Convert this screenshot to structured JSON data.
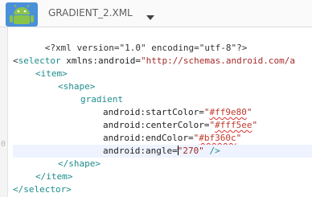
{
  "tab": {
    "title": "GRADIENT_2.XML",
    "icon": "android-file-icon",
    "dropdown_icon": "chevron-down-icon"
  },
  "gutter": {
    "visible_number": "0"
  },
  "code": {
    "line1": {
      "text": "<?xml version=\"1.0\" encoding=\"utf-8\"?>"
    },
    "line2": {
      "open": "<",
      "tag": "selector",
      "attr": " xmlns:android=",
      "value": "\"http://schemas.android.com/a"
    },
    "line3": {
      "open": "<",
      "tag": "item",
      "close": ">"
    },
    "line4": {
      "open": "<",
      "tag": "shape",
      "close": ">"
    },
    "line5": {
      "tag": "gradient"
    },
    "line6": {
      "attr": "android:startColor=",
      "q1": "\"",
      "value": "#ff9e80",
      "q2": "\""
    },
    "line7": {
      "attr": "android:centerColor=",
      "q1": "\"",
      "value": "#fff5ee",
      "q2": "\""
    },
    "line8": {
      "attr": "android:endColor=",
      "q1": "\"",
      "value": "#bf360c",
      "q2": "\""
    },
    "line9": {
      "attr": "android:angle=",
      "value": "\"270\"",
      "close": " />"
    },
    "line10": {
      "open": "</",
      "tag": "shape",
      "close": ">"
    },
    "line11": {
      "open": "</",
      "tag": "item",
      "close": ">"
    },
    "line12": {
      "open": "</",
      "tag": "selector",
      "close": ">"
    }
  },
  "colors": {
    "accent_tag": "#1f8c8c",
    "value": "#a52a2a",
    "android_green": "#8bc34a"
  }
}
